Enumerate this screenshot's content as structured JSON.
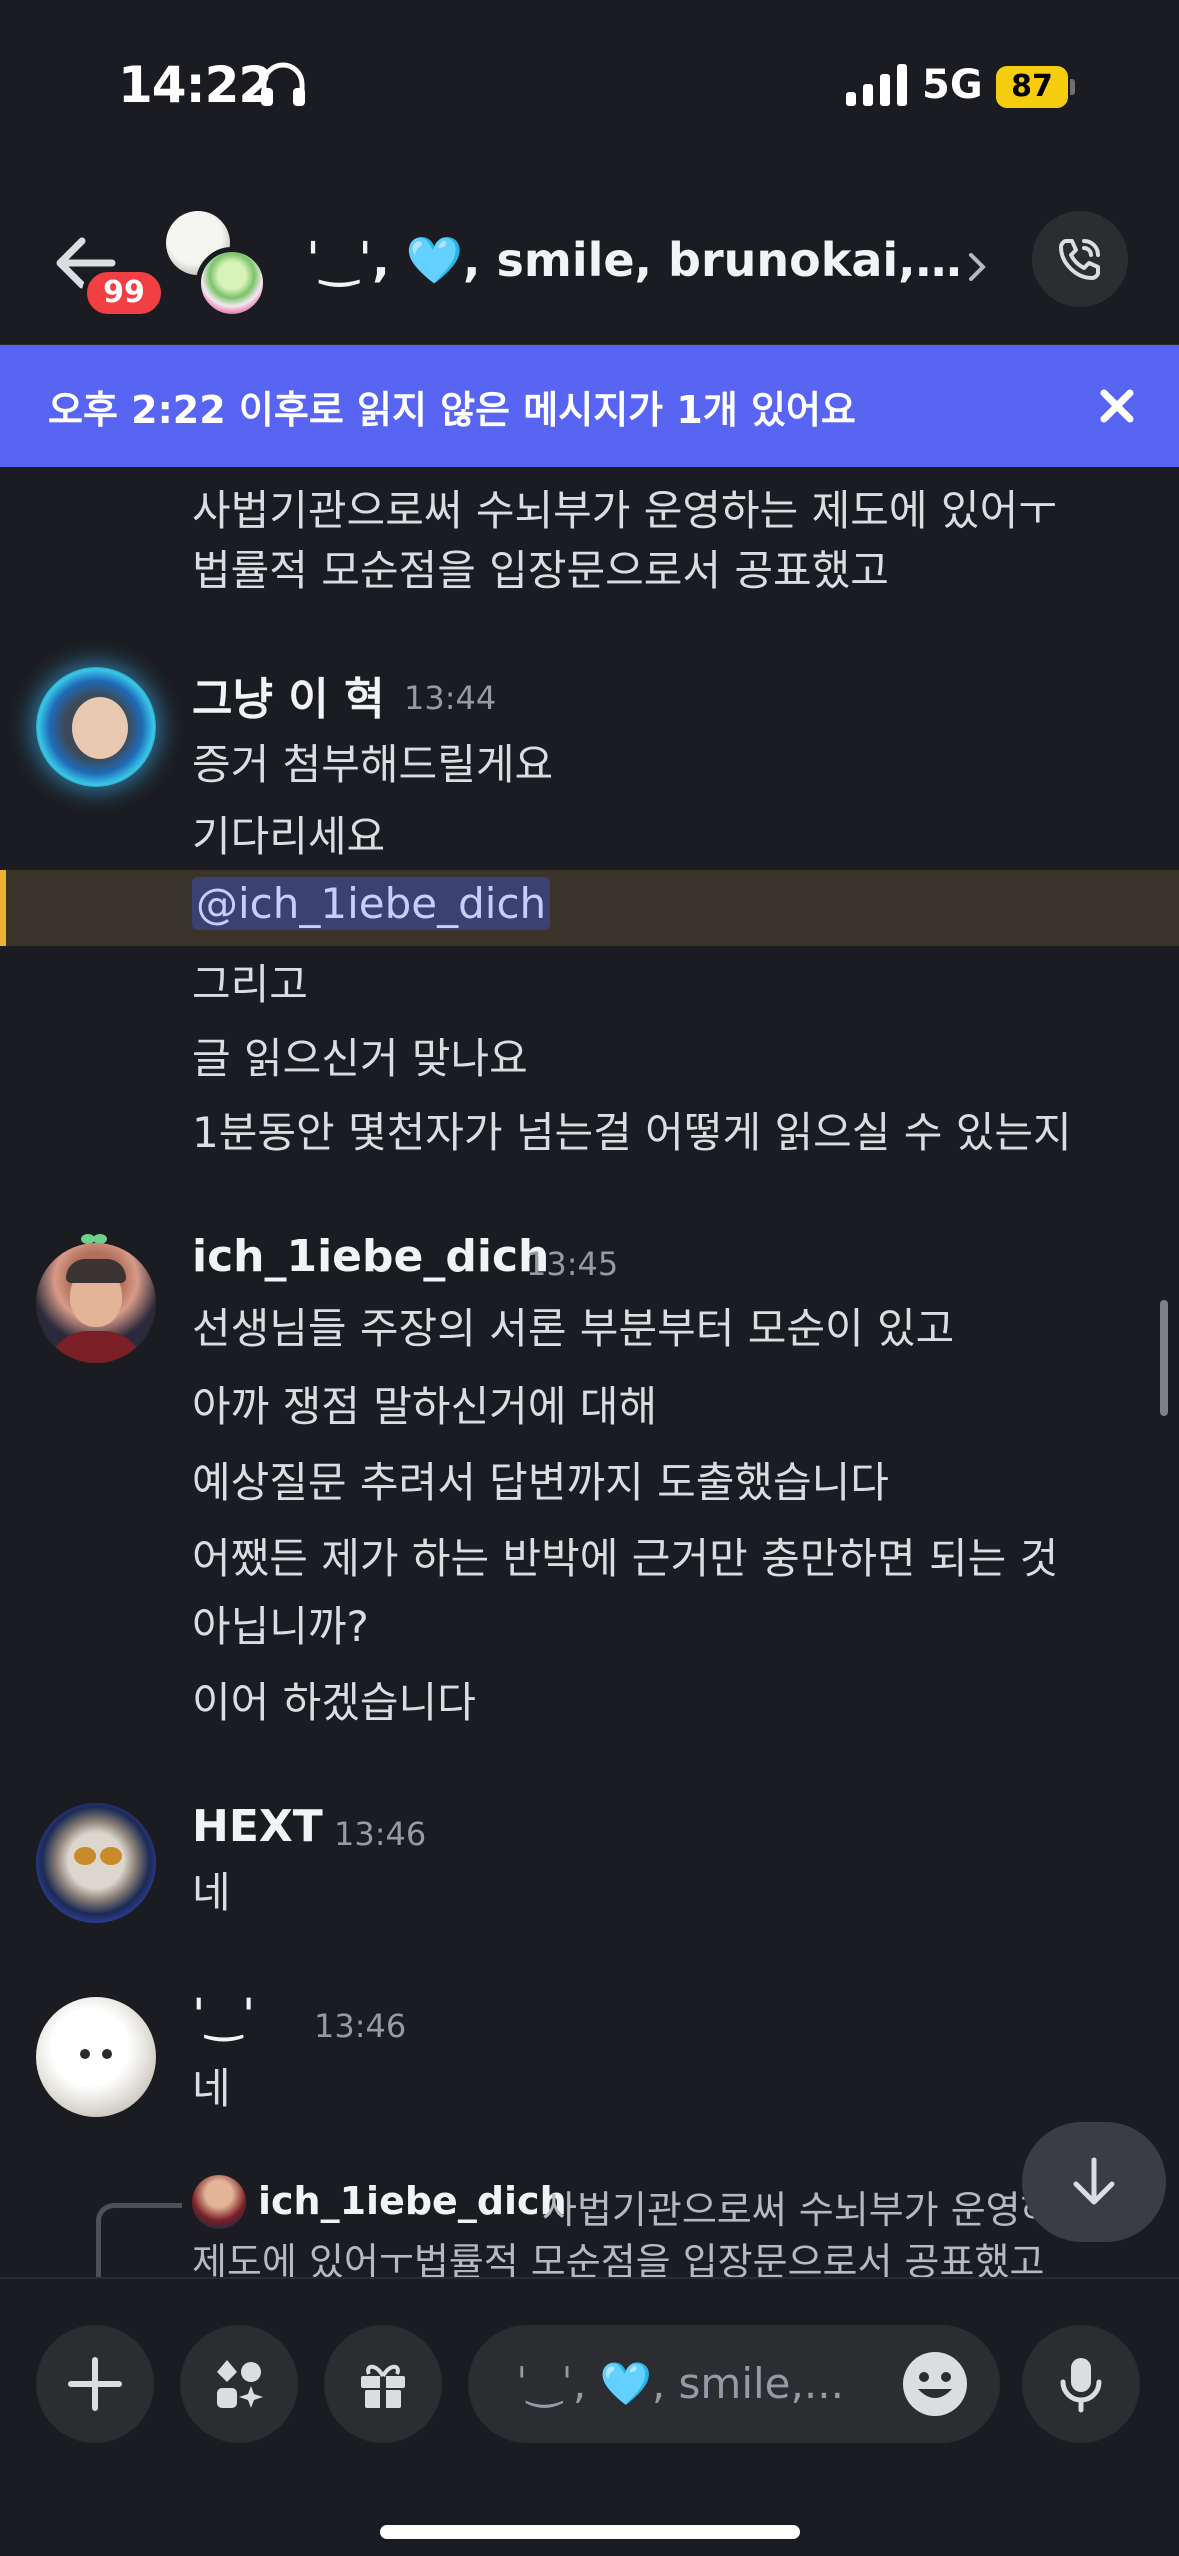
{
  "status_bar": {
    "time": "14:22",
    "network": "5G",
    "battery": "87"
  },
  "header": {
    "unread_count": "99",
    "channel_title": "ˈ‿ˈ, 🩵, smile, brunokai,..."
  },
  "banner": {
    "text": "오후 2:22 이후로 읽지 않은 메시지가 1개 있어요"
  },
  "messages": {
    "continuation": [
      "사법기관으로써 수뇌부가 운영하는 제도에 있어ㅜ",
      "법률적 모순점을 입장문으로서 공표했고"
    ],
    "group1": {
      "author": "그냥 이 혁",
      "time": "13:44",
      "lines": [
        "증거 첨부해드릴게요",
        "기다리세요"
      ],
      "mention": "@ich_1iebe_dich",
      "lines2": [
        "그리고",
        "글 읽으신거 맞나요",
        "1분동안 몇천자가 넘는걸 어떻게 읽으실 수 있는지"
      ]
    },
    "group2": {
      "author": "ich_1iebe_dich",
      "time": "13:45",
      "lines": [
        "선생님들 주장의 서론 부분부터 모순이 있고",
        "아까 쟁점 말하신거에 대해",
        "예상질문 추려서 답변까지 도출했습니다",
        "어쨌든 제가 하는 반박에 근거만 충만하면 되는 것",
        "아닙니까?",
        "이어 하겠습니다"
      ]
    },
    "group3": {
      "author": "HEXT",
      "time": "13:46",
      "lines": [
        "네"
      ]
    },
    "group4": {
      "author": "ˈ‿ˈ",
      "time": "13:46",
      "lines": [
        "네"
      ]
    },
    "reply": {
      "author": "ich_1iebe_dich",
      "text_line1": "사법기관으로써 수뇌부가 운영하는",
      "text_line2": "제도에 있어ㅜ법률적 모순점을 입장문으로서 공표했고"
    }
  },
  "composer": {
    "placeholder": "ˈ‿ˈ, 🩵, smile,..."
  },
  "colors": {
    "accent": "#5865f2",
    "badge": "#f23f43",
    "background": "#1b1c21",
    "mention_bar": "#f0b232"
  }
}
